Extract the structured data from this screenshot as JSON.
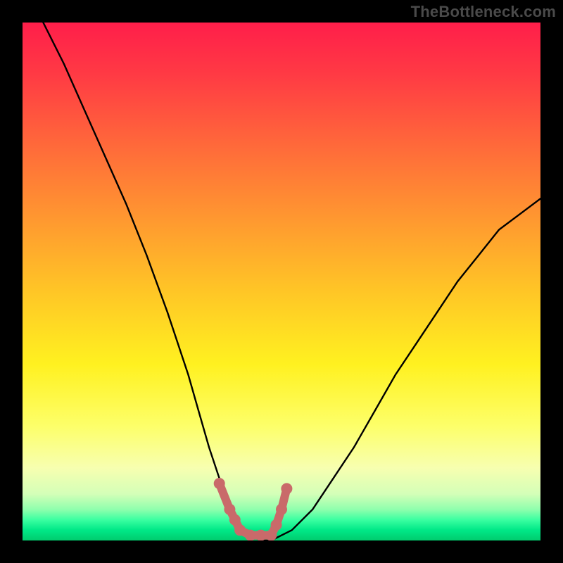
{
  "watermark": "TheBottleneck.com",
  "chart_data": {
    "type": "line",
    "title": "",
    "xlabel": "",
    "ylabel": "",
    "xlim": [
      0,
      100
    ],
    "ylim": [
      0,
      100
    ],
    "grid": false,
    "legend": false,
    "background_gradient": {
      "direction": "vertical",
      "stops": [
        {
          "pos": 0,
          "color": "#ff1e4a"
        },
        {
          "pos": 10,
          "color": "#ff3a44"
        },
        {
          "pos": 24,
          "color": "#ff6a3a"
        },
        {
          "pos": 38,
          "color": "#ff9830"
        },
        {
          "pos": 52,
          "color": "#ffc626"
        },
        {
          "pos": 66,
          "color": "#fff120"
        },
        {
          "pos": 78,
          "color": "#fdff6a"
        },
        {
          "pos": 86,
          "color": "#f7ffb0"
        },
        {
          "pos": 91,
          "color": "#d4ffb8"
        },
        {
          "pos": 94,
          "color": "#8fffad"
        },
        {
          "pos": 96,
          "color": "#3bffa1"
        },
        {
          "pos": 98,
          "color": "#00e887"
        },
        {
          "pos": 100,
          "color": "#00cc6e"
        }
      ]
    },
    "series": [
      {
        "name": "bottleneck-curve",
        "color": "#000000",
        "x": [
          4,
          8,
          12,
          16,
          20,
          24,
          28,
          30,
          32,
          34,
          36,
          38,
          40,
          42,
          44,
          46,
          48,
          52,
          56,
          60,
          64,
          68,
          72,
          76,
          80,
          84,
          88,
          92,
          96,
          100
        ],
        "y": [
          100,
          92,
          83,
          74,
          65,
          55,
          44,
          38,
          32,
          25,
          18,
          12,
          7,
          3,
          1,
          0,
          0,
          2,
          6,
          12,
          18,
          25,
          32,
          38,
          44,
          50,
          55,
          60,
          63,
          66
        ]
      }
    ],
    "markers": {
      "name": "optimal-range",
      "color": "#c96a6a",
      "points": [
        {
          "x": 38,
          "y": 11
        },
        {
          "x": 40,
          "y": 6
        },
        {
          "x": 41,
          "y": 4
        },
        {
          "x": 42,
          "y": 2
        },
        {
          "x": 44,
          "y": 1
        },
        {
          "x": 46,
          "y": 1
        },
        {
          "x": 48,
          "y": 1
        },
        {
          "x": 49,
          "y": 3
        },
        {
          "x": 50,
          "y": 6
        },
        {
          "x": 51,
          "y": 10
        }
      ]
    }
  }
}
